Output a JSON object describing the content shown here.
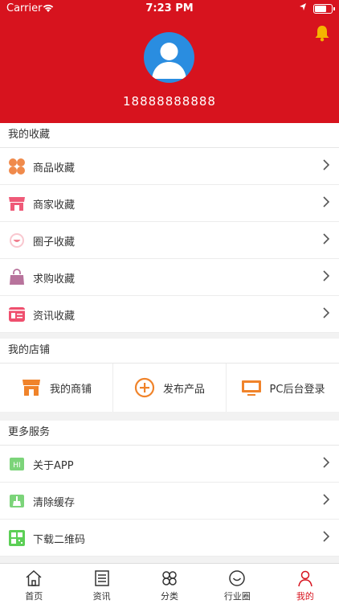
{
  "status_bar": {
    "carrier": "Carrier",
    "time": "7:23 PM",
    "battery_level": 0.75
  },
  "profile": {
    "phone": "18888888888"
  },
  "favorites": {
    "title": "我的收藏",
    "items": [
      {
        "label": "商品收藏",
        "icon": "clover-icon",
        "color": "#f08a4b"
      },
      {
        "label": "商家收藏",
        "icon": "store-icon",
        "color": "#ef5a78"
      },
      {
        "label": "圈子收藏",
        "icon": "smile-circle-icon",
        "color": "#f07f8f"
      },
      {
        "label": "求购收藏",
        "icon": "bag-icon",
        "color": "#b8739c"
      },
      {
        "label": "资讯收藏",
        "icon": "news-card-icon",
        "color": "#ef4f6e"
      }
    ]
  },
  "shop": {
    "title": "我的店铺",
    "items": [
      {
        "label": "我的商铺",
        "icon": "shop-icon",
        "color": "#f0832a"
      },
      {
        "label": "发布产品",
        "icon": "plus-circle-icon",
        "color": "#f0832a"
      },
      {
        "label": "PC后台登录",
        "icon": "monitor-icon",
        "color": "#f0832a"
      }
    ]
  },
  "services": {
    "title": "更多服务",
    "items": [
      {
        "label": "关于APP",
        "icon": "hi-icon",
        "color": "#7cd47a"
      },
      {
        "label": "清除缓存",
        "icon": "broom-icon",
        "color": "#7cd47a"
      },
      {
        "label": "下载二维码",
        "icon": "qrcode-icon",
        "color": "#5ccf56"
      }
    ]
  },
  "tabbar": {
    "items": [
      {
        "label": "首页",
        "icon": "home-icon"
      },
      {
        "label": "资讯",
        "icon": "news-icon"
      },
      {
        "label": "分类",
        "icon": "category-icon"
      },
      {
        "label": "行业圈",
        "icon": "circle-icon"
      },
      {
        "label": "我的",
        "icon": "user-icon",
        "active": true
      }
    ]
  },
  "colors": {
    "brand_red": "#d7131e",
    "avatar_blue": "#2a8de0",
    "bell_yellow": "#f5b400"
  }
}
